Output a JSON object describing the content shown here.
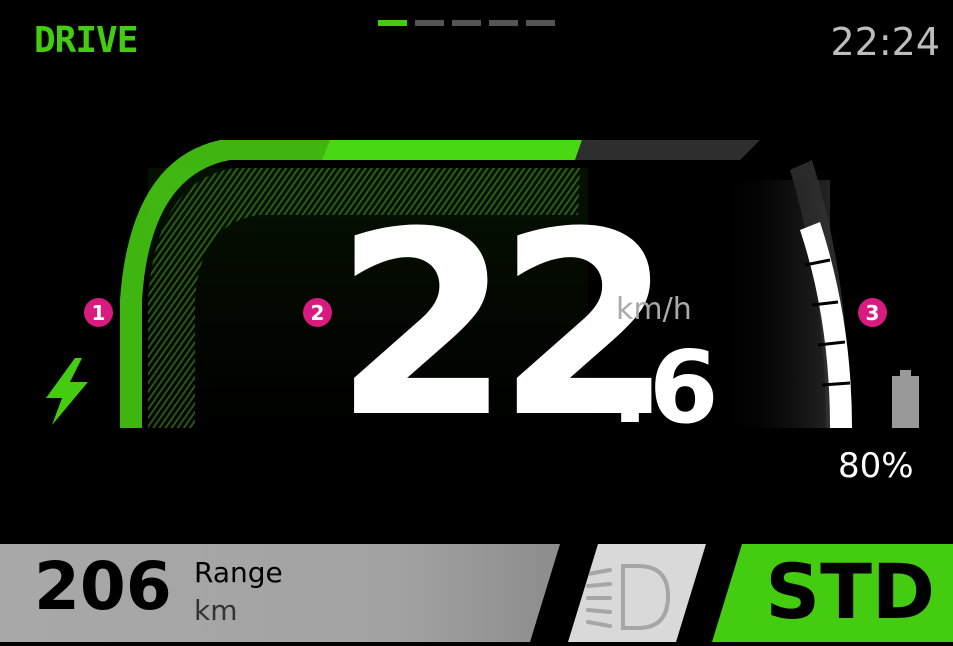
{
  "header": {
    "mode": "DRIVE",
    "time": "22:24",
    "pages_total": 5,
    "page_active": 1
  },
  "gauge": {
    "power_level": 0.55,
    "battery_level": 0.8,
    "callouts": [
      "1",
      "2",
      "3"
    ]
  },
  "speed": {
    "integer": "22",
    "decimal": ".6",
    "unit": "km/h"
  },
  "battery": {
    "percent": "80%"
  },
  "range": {
    "value": "206",
    "label": "Range",
    "unit": "km"
  },
  "ride_mode": {
    "label": "STD"
  },
  "icons": {
    "power": "lightning-bolt-icon",
    "battery": "battery-icon",
    "headlight": "headlight-icon"
  },
  "colors": {
    "accent": "#44cc11",
    "callout": "#d81b7e",
    "background": "#000000"
  }
}
